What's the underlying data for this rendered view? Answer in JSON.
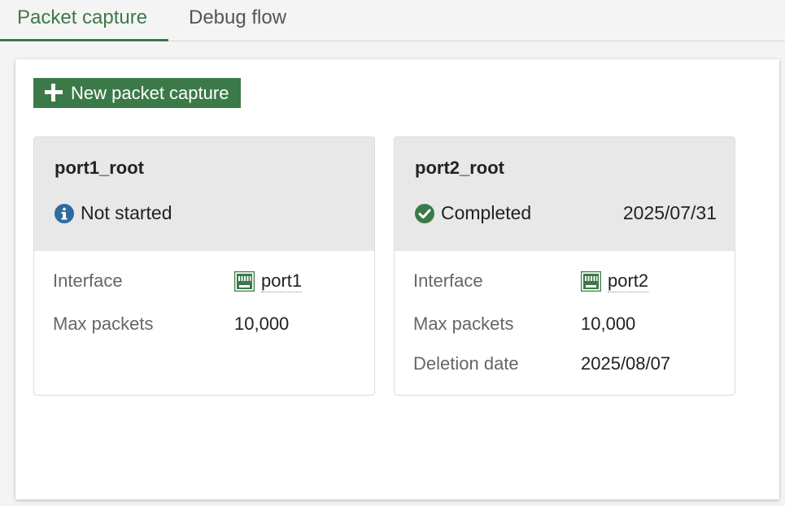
{
  "tabs": [
    {
      "label": "Packet capture",
      "active": true
    },
    {
      "label": "Debug flow",
      "active": false
    }
  ],
  "toolbar": {
    "new_label": "New packet capture"
  },
  "cards": [
    {
      "title": "port1_root",
      "status": {
        "icon": "info-icon",
        "text": "Not started",
        "date": ""
      },
      "interface_label": "Interface",
      "interface_value": "port1",
      "max_packets_label": "Max packets",
      "max_packets_value": "10,000"
    },
    {
      "title": "port2_root",
      "status": {
        "icon": "check-circle-icon",
        "text": "Completed",
        "date": "2025/07/31"
      },
      "interface_label": "Interface",
      "interface_value": "port2",
      "max_packets_label": "Max packets",
      "max_packets_value": "10,000",
      "deletion_label": "Deletion date",
      "deletion_value": "2025/08/07"
    }
  ],
  "colors": {
    "accent": "#3b7a48",
    "info": "#2e6b9e",
    "success": "#3b7a48",
    "card_header": "#e8e8e8"
  }
}
